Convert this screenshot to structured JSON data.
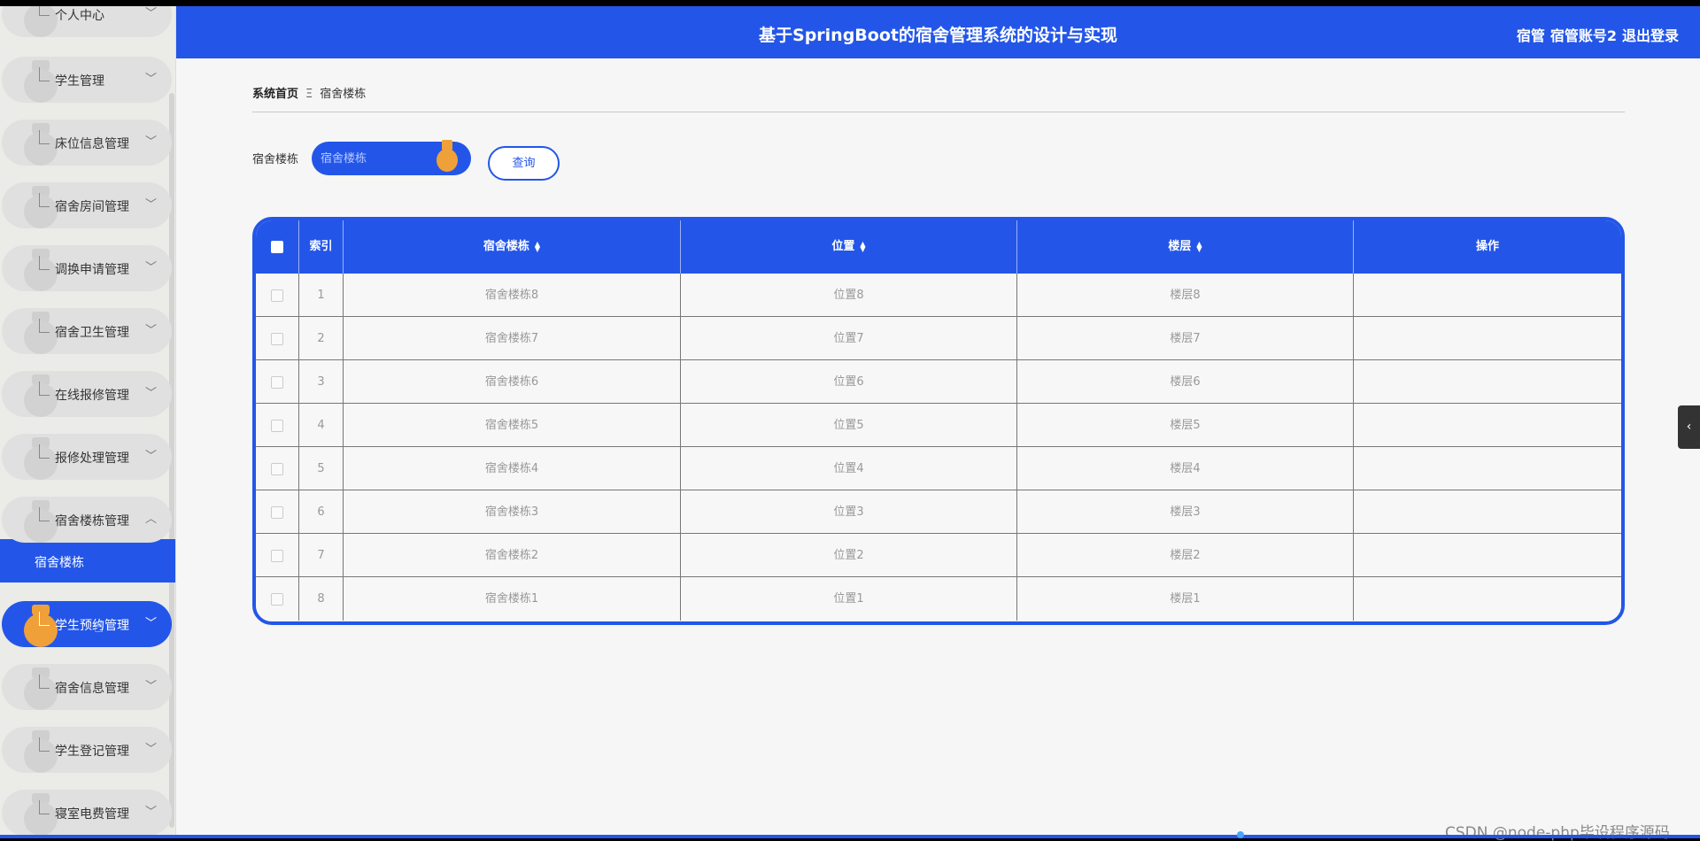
{
  "header": {
    "title": "基于SpringBoot的宿舍管理系统的设计与实现",
    "role": "宿管",
    "account": "宿管账号2",
    "logout": "退出登录"
  },
  "sidebar": {
    "items": [
      {
        "label": "个人中心",
        "active": false
      },
      {
        "label": "学生管理",
        "active": false
      },
      {
        "label": "床位信息管理",
        "active": false
      },
      {
        "label": "宿舍房间管理",
        "active": false
      },
      {
        "label": "调换申请管理",
        "active": false
      },
      {
        "label": "宿舍卫生管理",
        "active": false
      },
      {
        "label": "在线报修管理",
        "active": false
      },
      {
        "label": "报修处理管理",
        "active": false
      },
      {
        "label": "宿舍楼栋管理",
        "active": false,
        "expanded": true
      },
      {
        "label": "学生预约管理",
        "active": true
      },
      {
        "label": "宿舍信息管理",
        "active": false
      },
      {
        "label": "学生登记管理",
        "active": false
      },
      {
        "label": "寝室电费管理",
        "active": false
      }
    ],
    "submenu": {
      "label": "宿舍楼栋"
    }
  },
  "breadcrumb": {
    "home": "系统首页",
    "separator": "Ξ",
    "current": "宿舍楼栋"
  },
  "search": {
    "label": "宿舍楼栋",
    "placeholder": "宿舍楼栋",
    "button": "查询"
  },
  "table": {
    "headers": {
      "index": "索引",
      "building": "宿舍楼栋",
      "location": "位置",
      "floor": "楼层",
      "actions": "操作"
    },
    "rows": [
      {
        "index": "1",
        "building": "宿舍楼栋8",
        "location": "位置8",
        "floor": "楼层8"
      },
      {
        "index": "2",
        "building": "宿舍楼栋7",
        "location": "位置7",
        "floor": "楼层7"
      },
      {
        "index": "3",
        "building": "宿舍楼栋6",
        "location": "位置6",
        "floor": "楼层6"
      },
      {
        "index": "4",
        "building": "宿舍楼栋5",
        "location": "位置5",
        "floor": "楼层5"
      },
      {
        "index": "5",
        "building": "宿舍楼栋4",
        "location": "位置4",
        "floor": "楼层4"
      },
      {
        "index": "6",
        "building": "宿舍楼栋3",
        "location": "位置3",
        "floor": "楼层3"
      },
      {
        "index": "7",
        "building": "宿舍楼栋2",
        "location": "位置2",
        "floor": "楼层2"
      },
      {
        "index": "8",
        "building": "宿舍楼栋1",
        "location": "位置1",
        "floor": "楼层1"
      }
    ]
  },
  "watermark": "CSDN @node-php毕设程序源码",
  "colors": {
    "primary": "#2356e8",
    "accent": "#f0a038",
    "background": "#f6f6f6"
  },
  "icons": {
    "chevron": "chevron-down-icon",
    "collapse": "chevron-left-icon",
    "sort": "sort-icon"
  }
}
